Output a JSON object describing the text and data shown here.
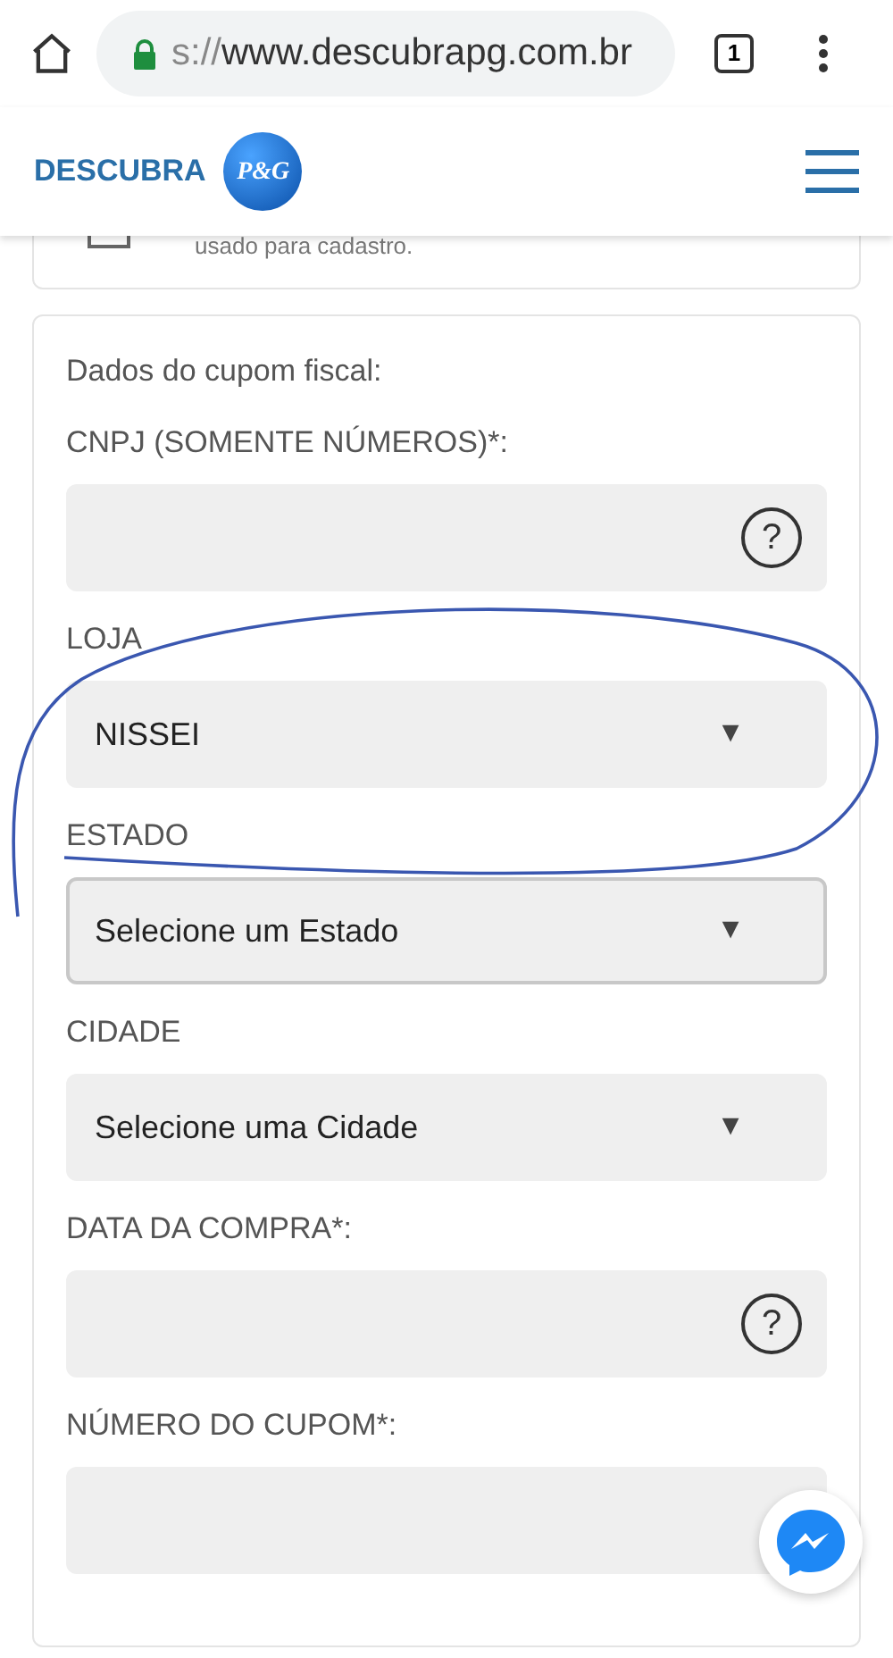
{
  "browser": {
    "url_scheme": "s://",
    "url_host": "www.descubrapg.com.br",
    "tab_count": "1"
  },
  "header": {
    "brand": "DESCUBRA",
    "logo": "P&G"
  },
  "previous_card": {
    "note": "usado para cadastro."
  },
  "form": {
    "title": "Dados do cupom fiscal:",
    "fields": [
      {
        "kind": "text",
        "label": "CNPJ (SOMENTE NÚMEROS)*:",
        "help": "?",
        "focused": false
      },
      {
        "kind": "select",
        "label": "LOJA",
        "value": "NISSEI",
        "arrow": "▼",
        "focused": false
      },
      {
        "kind": "select",
        "label": "ESTADO",
        "value": "Selecione um Estado",
        "arrow": "▼",
        "focused": true
      },
      {
        "kind": "select",
        "label": "CIDADE",
        "value": "Selecione uma Cidade",
        "arrow": "▼",
        "focused": false
      },
      {
        "kind": "text",
        "label": "DATA DA COMPRA*:",
        "help": "?",
        "focused": false
      },
      {
        "kind": "text",
        "label": "NÚMERO DO CUPOM*:",
        "focused": false
      }
    ]
  }
}
